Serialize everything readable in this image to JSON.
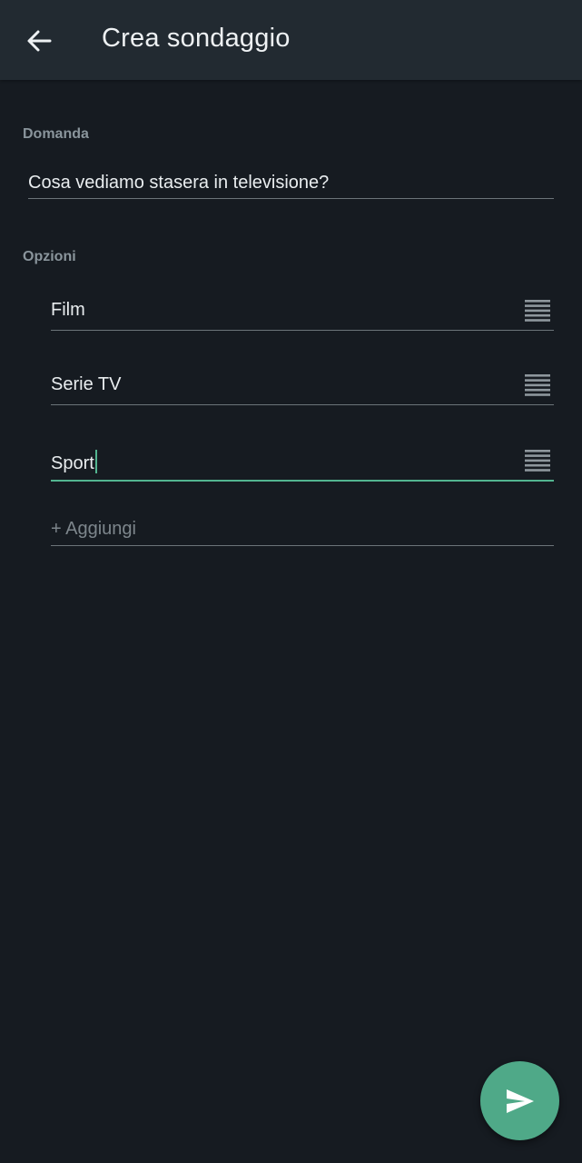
{
  "header": {
    "title": "Crea sondaggio",
    "back_icon": "arrow-left-icon"
  },
  "question": {
    "label": "Domanda",
    "value": "Cosa vediamo stasera in televisione?"
  },
  "options": {
    "label": "Opzioni",
    "items": [
      {
        "value": "Film"
      },
      {
        "value": "Serie TV"
      },
      {
        "value": "Sport"
      }
    ],
    "add_placeholder": "+ Aggiungi"
  },
  "fab": {
    "icon": "send-icon"
  },
  "colors": {
    "background": "#161b21",
    "app_bar": "#222a31",
    "accent": "#53b590",
    "fab": "#4fa988"
  }
}
